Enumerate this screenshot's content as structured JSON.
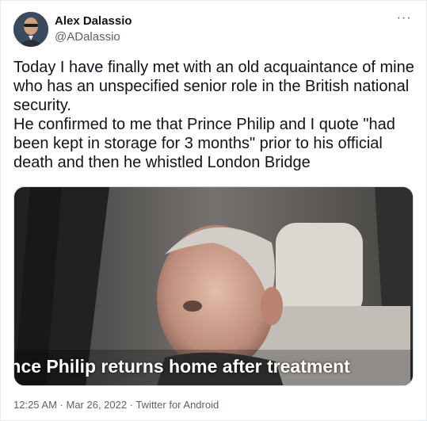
{
  "author": {
    "display_name": "Alex Dalassio",
    "handle": "@ADalassio"
  },
  "more_icon": "ellipsis-icon",
  "tweet": {
    "line1": "Today I have finally met with an old acquaintance of mine who has an unspecified senior role in the British national security.",
    "line2": "He confirmed to me that Prince Philip and I quote \"had been kept in storage for 3 months\" prior to his official death and then he whistled London Bridge"
  },
  "media": {
    "caption": "ince Philip returns home after treatment"
  },
  "meta": {
    "time": "12:25 AM",
    "separator": " · ",
    "date": "Mar 26, 2022",
    "source": "Twitter for Android"
  },
  "colors": {
    "text": "#0f1419",
    "secondary": "#536471",
    "border": "#cfd9de"
  }
}
